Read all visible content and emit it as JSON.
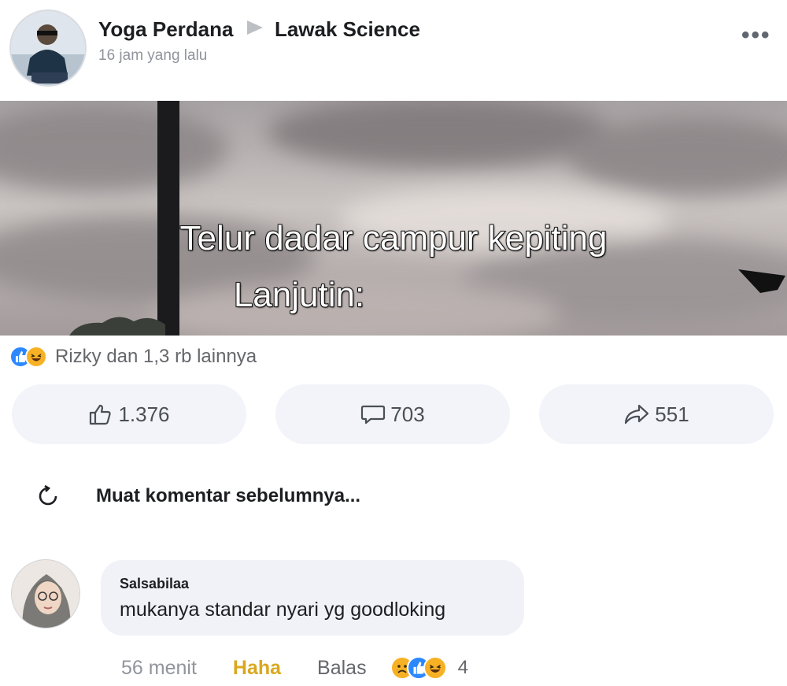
{
  "post": {
    "author": "Yoga Perdana",
    "group": "Lawak Science",
    "timestamp": "16 jam yang lalu"
  },
  "media": {
    "caption_line1": "Telur dadar campur kepiting",
    "caption_line2": "Lanjutin:"
  },
  "reactions": {
    "summary": "Rizky dan 1,3 rb lainnya"
  },
  "actions": {
    "like_count": "1.376",
    "comment_count": "703",
    "share_count": "551"
  },
  "comments": {
    "load_more": "Muat komentar sebelumnya...",
    "items": [
      {
        "author": "Salsabilaa",
        "text": "mukanya standar nyari yg goodloking",
        "time": "56 menit",
        "haha_label": "Haha",
        "reply_label": "Balas",
        "reaction_count": "4"
      }
    ]
  },
  "colors": {
    "like_blue": "#2d88ff",
    "haha_yellow": "#f7b125",
    "button_bg": "#f2f4f9"
  }
}
